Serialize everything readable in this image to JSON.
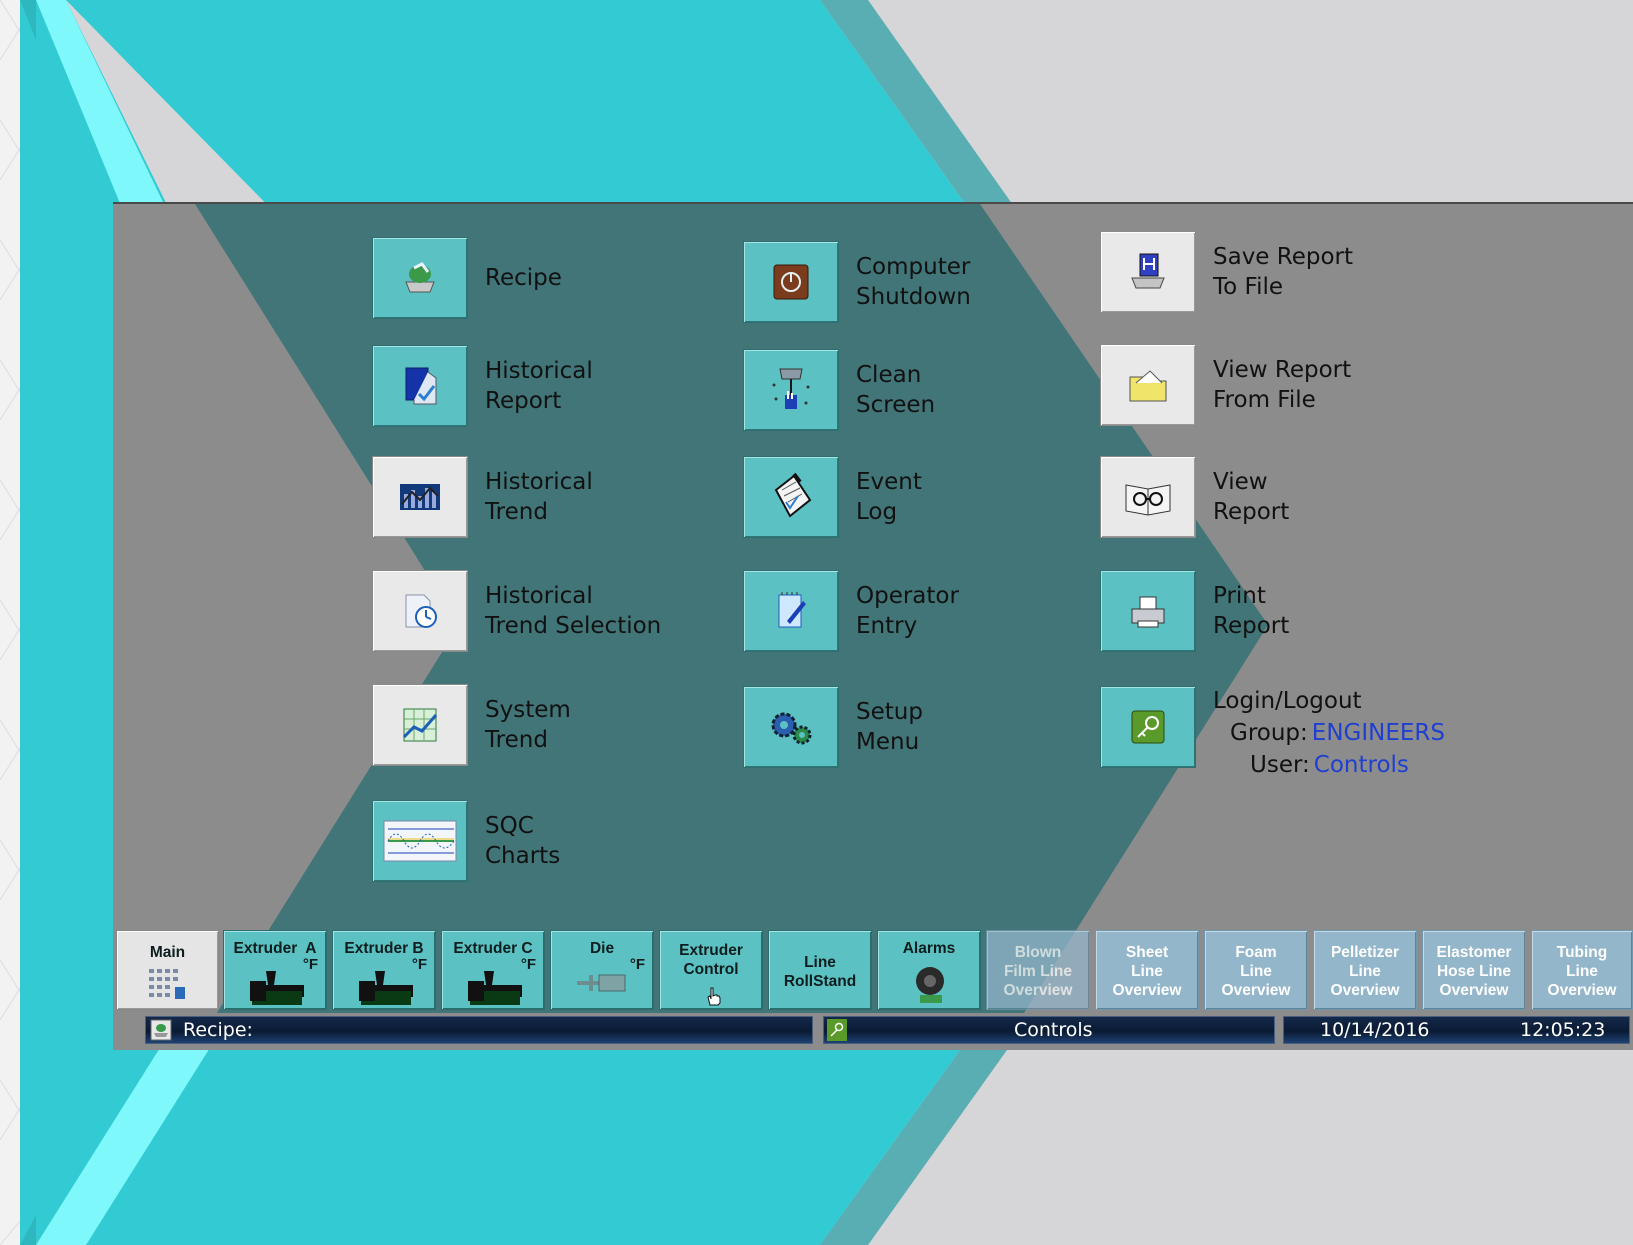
{
  "menu": {
    "recipe": "Recipe",
    "historical_report": "Historical\nReport",
    "historical_trend": "Historical\nTrend",
    "historical_trend_selection": "Historical\nTrend Selection",
    "system_trend": "System\nTrend",
    "sqc_charts": "SQC\nCharts",
    "computer_shutdown": "Computer\nShutdown",
    "clean_screen": "Clean\nScreen",
    "event_log": "Event\nLog",
    "operator_entry": "Operator\nEntry",
    "setup_menu": "Setup\nMenu",
    "save_report": "Save Report\nTo File",
    "view_report_file": "View Report\nFrom File",
    "view_report": "View\nReport",
    "print_report": "Print\nReport",
    "login_logout": "Login/Logout"
  },
  "login": {
    "group_label": "Group:",
    "group_value": "ENGINEERS",
    "user_label": "User:",
    "user_value": "Controls"
  },
  "nav": {
    "main": "Main",
    "extruder_a": "Extruder  A",
    "extruder_b": "Extruder B",
    "extruder_c": "Extruder C",
    "die": "Die",
    "degf": "°F",
    "extruder_control": "Extruder\nControl",
    "line_rollstand": "Line\nRollStand",
    "alarms": "Alarms",
    "blown_film": "Blown\nFilm Line\nOverview",
    "sheet": "Sheet\nLine\nOverview",
    "foam": "Foam\nLine\nOverview",
    "pelletizer": "Pelletizer\nLine\nOverview",
    "elastomer": "Elastomer\nHose Line\nOverview",
    "tubing": "Tubing\nLine\nOverview"
  },
  "status": {
    "recipe_label": "Recipe:",
    "user": "Controls",
    "date": "10/14/2016",
    "time": "12:05:23"
  },
  "colors": {
    "teal": "#33cbd3",
    "light_cyan": "#7ff8fc",
    "dark_overlay": "#2f6a6e",
    "panel_gray": "#8c8c8c",
    "link_blue": "#1f3fd0"
  }
}
